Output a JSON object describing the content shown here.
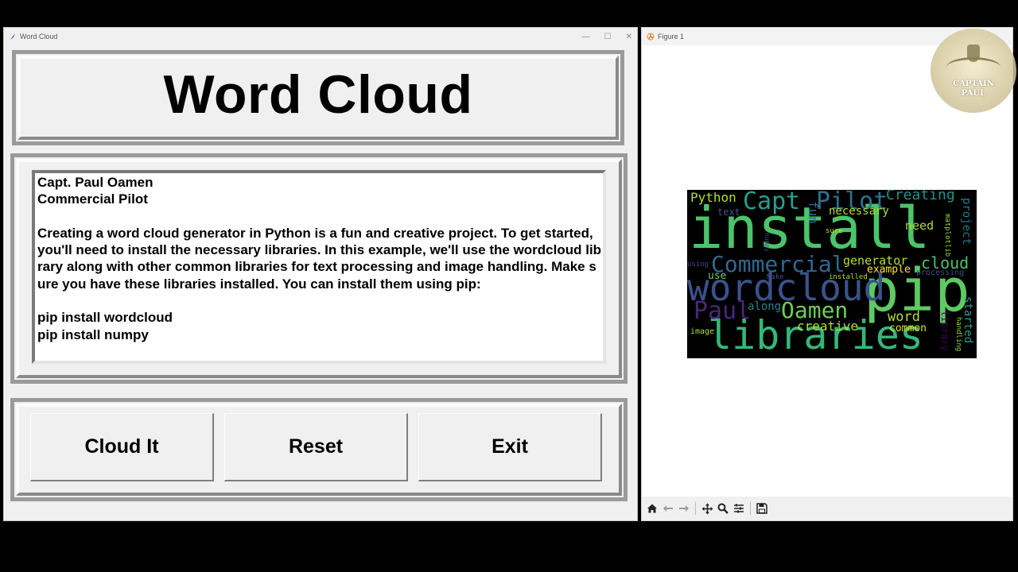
{
  "left_window": {
    "title": "Word Cloud",
    "app_title": "Word Cloud",
    "text_content": "Capt. Paul Oamen\nCommercial Pilot\n\nCreating a word cloud generator in Python is a fun and creative project. To get started, you'll need to install the necessary libraries. In this example, we'll use the wordcloud library along with other common libraries for text processing and image handling. Make sure you have these libraries installed. You can install them using pip:\n\npip install wordcloud\npip install numpy",
    "buttons": {
      "cloud_it": "Cloud It",
      "reset": "Reset",
      "exit": "Exit"
    }
  },
  "right_window": {
    "title": "Figure 1",
    "toolbar": [
      "home-icon",
      "back-arrow-icon",
      "forward-arrow-icon",
      "pan-icon",
      "zoom-icon",
      "configure-subplots-icon",
      "save-icon"
    ]
  },
  "badge": {
    "line1": "CAPTAIN",
    "line2": "PAUL"
  },
  "wordcloud_words": [
    {
      "text": "install",
      "color": "#4cc46a",
      "size": 72
    },
    {
      "text": "pip",
      "color": "#5ec962",
      "size": 74
    },
    {
      "text": "wordcloud",
      "color": "#3b528b",
      "size": 46
    },
    {
      "text": "libraries",
      "color": "#35b779",
      "size": 50
    },
    {
      "text": "Commercial",
      "color": "#31688e",
      "size": 28
    },
    {
      "text": "Capt",
      "color": "#2a9d8f",
      "size": 30
    },
    {
      "text": "Pilot",
      "color": "#2c728e",
      "size": 30
    },
    {
      "text": "Paul",
      "color": "#482878",
      "size": 30
    },
    {
      "text": "Oamen",
      "color": "#6ece58",
      "size": 28
    },
    {
      "text": "Creating",
      "color": "#21918c",
      "size": 18
    },
    {
      "text": "Python",
      "color": "#b5de2b",
      "size": 16
    },
    {
      "text": "fun",
      "color": "#31688e",
      "size": 16
    },
    {
      "text": "necessary",
      "color": "#b5de2b",
      "size": 14
    },
    {
      "text": "text",
      "color": "#3b528b",
      "size": 12
    },
    {
      "text": "need",
      "color": "#aadc32",
      "size": 15
    },
    {
      "text": "project",
      "color": "#2a788e",
      "size": 14
    },
    {
      "text": "matplotlib",
      "color": "#9bd93c",
      "size": 9
    },
    {
      "text": "sure",
      "color": "#c8e020",
      "size": 9
    },
    {
      "text": "generator",
      "color": "#b5de2b",
      "size": 15
    },
    {
      "text": "cloud",
      "color": "#4ac16d",
      "size": 20
    },
    {
      "text": "example",
      "color": "#fde725",
      "size": 13
    },
    {
      "text": "processing",
      "color": "#3e4a89",
      "size": 10
    },
    {
      "text": "use",
      "color": "#6ece58",
      "size": 13
    },
    {
      "text": "using",
      "color": "#3e4a89",
      "size": 9
    },
    {
      "text": "installed",
      "color": "#b5de2b",
      "size": 9
    },
    {
      "text": "Make",
      "color": "#3e4a89",
      "size": 9
    },
    {
      "text": "along",
      "color": "#26828e",
      "size": 14
    },
    {
      "text": "creative",
      "color": "#b5de2b",
      "size": 16
    },
    {
      "text": "word",
      "color": "#b5de2b",
      "size": 17
    },
    {
      "text": "common",
      "color": "#dde318",
      "size": 13
    },
    {
      "text": "library",
      "color": "#440154",
      "size": 12
    },
    {
      "text": "handling",
      "color": "#8fd744",
      "size": 9
    },
    {
      "text": "started",
      "color": "#2a9d8f",
      "size": 14
    },
    {
      "text": "image",
      "color": "#b5de2b",
      "size": 10
    },
    {
      "text": "numpy",
      "color": "#3e4a89",
      "size": 8
    }
  ]
}
